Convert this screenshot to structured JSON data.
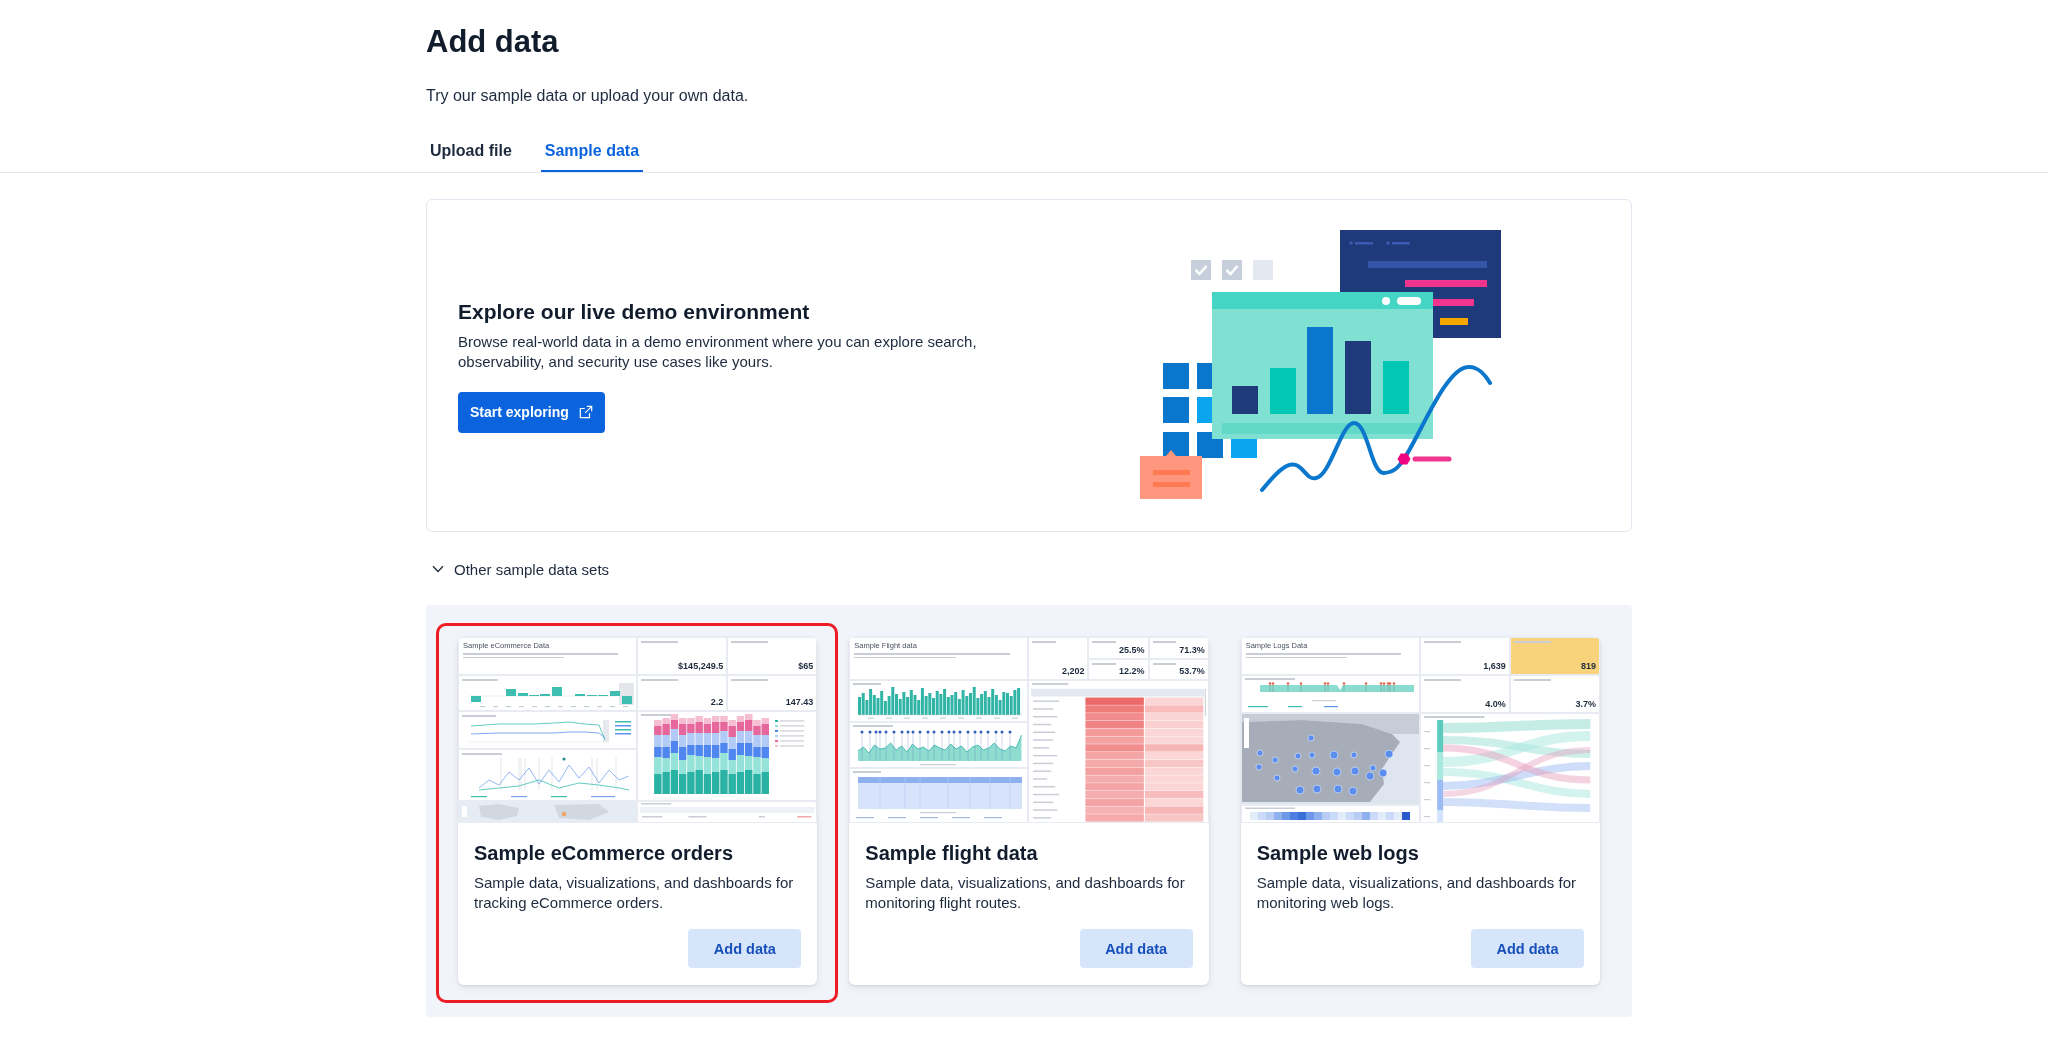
{
  "page": {
    "title": "Add data",
    "subtitle": "Try our sample data or upload your own data."
  },
  "tabs": [
    {
      "label": "Upload file",
      "selected": false
    },
    {
      "label": "Sample data",
      "selected": true
    }
  ],
  "demo_banner": {
    "title": "Explore our live demo environment",
    "description": "Browse real-world data in a demo environment where you can explore search, observability, and security use cases like yours.",
    "button": "Start exploring"
  },
  "other_sample_data_sets": {
    "label": "Other sample data sets",
    "expanded": true
  },
  "cards": [
    {
      "title": "Sample eCommerce orders",
      "description": "Sample data, visualizations, and dashboards for tracking eCommerce orders.",
      "button": "Add data",
      "highlighted": true,
      "preview": {
        "kind": "ecommerce",
        "title": "Sample eCommerce Data",
        "metrics": [
          {
            "value": "$145,249.5"
          },
          {
            "value": "$65"
          },
          {
            "value": "2.2"
          },
          {
            "value": "147.43"
          }
        ]
      }
    },
    {
      "title": "Sample flight data",
      "description": "Sample data, visualizations, and dashboards for monitoring flight routes.",
      "button": "Add data",
      "highlighted": false,
      "preview": {
        "kind": "flights",
        "title": "Sample Flight data",
        "metrics": [
          {
            "value": "25.5%"
          },
          {
            "value": "71.3%"
          },
          {
            "value": "2,202"
          },
          {
            "value": "12.2%"
          },
          {
            "value": "53.7%"
          }
        ]
      }
    },
    {
      "title": "Sample web logs",
      "description": "Sample data, visualizations, and dashboards for monitoring web logs.",
      "button": "Add data",
      "highlighted": false,
      "preview": {
        "kind": "logs",
        "title": "Sample Logs Data",
        "metrics": [
          {
            "value": "1,639"
          },
          {
            "value": "819",
            "color": "#f9d37b"
          },
          {
            "value": "4.0%"
          },
          {
            "value": "3.7%"
          }
        ]
      }
    }
  ]
}
